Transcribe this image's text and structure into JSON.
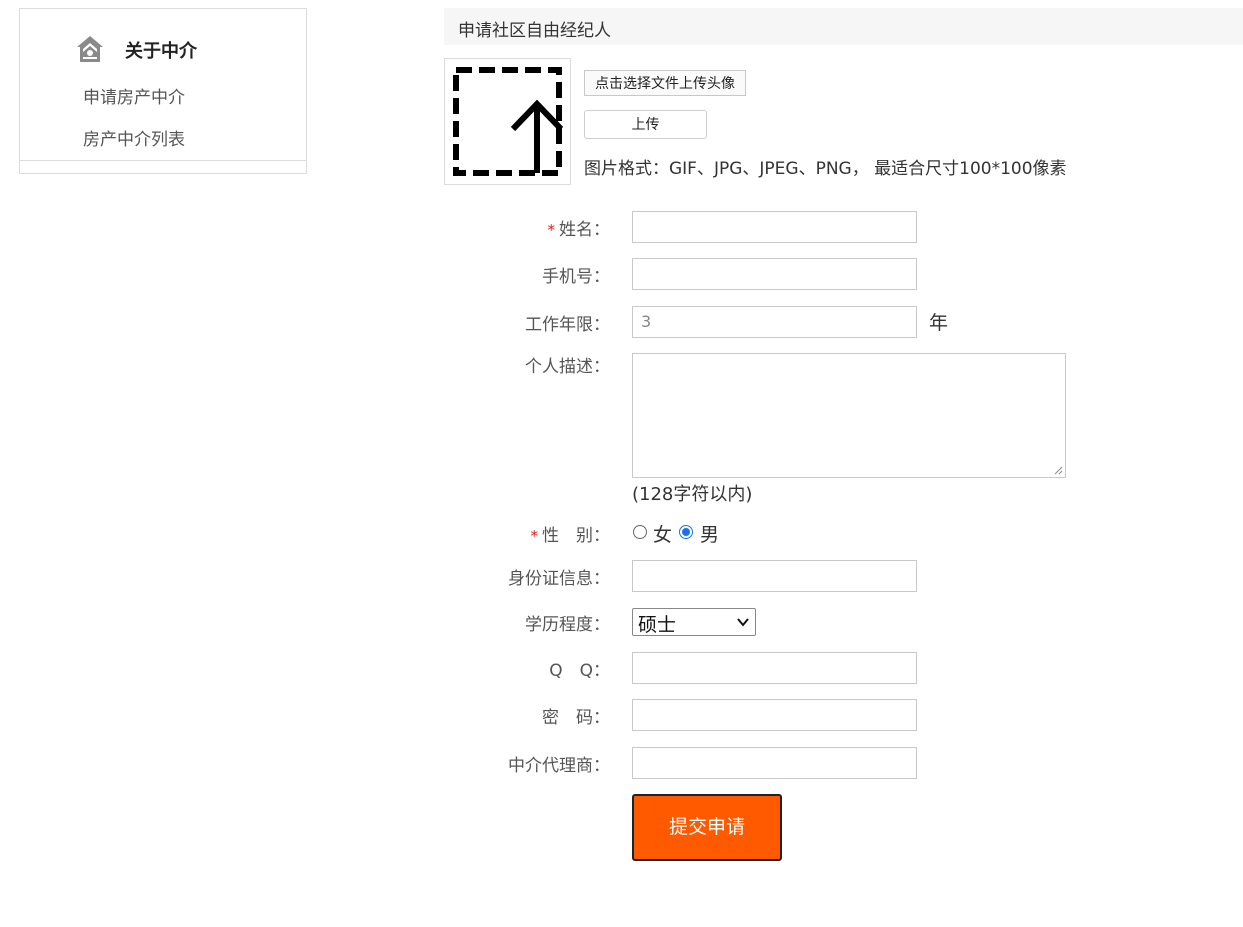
{
  "sidebar": {
    "icon": "house-icon",
    "title": "关于中介",
    "items": [
      {
        "label": "申请房产中介"
      },
      {
        "label": "房产中介列表"
      }
    ]
  },
  "header": {
    "title": "申请社区自由经纪人"
  },
  "avatar": {
    "icon": "upload-arrow-icon",
    "choose_file_label": "点击选择文件上传头像",
    "upload_label": "上传",
    "format_note": "图片格式：GIF、JPG、JPEG、PNG， 最适合尺寸100*100像素"
  },
  "form": {
    "required_mark": "*",
    "name": {
      "label": "姓名：",
      "value": ""
    },
    "phone": {
      "label": "手机号：",
      "value": ""
    },
    "years": {
      "label": "工作年限：",
      "value": "3",
      "unit": "年"
    },
    "description": {
      "label": "个人描述：",
      "value": "",
      "hint": "(128字符以内)"
    },
    "gender": {
      "label": "性　别：",
      "options": [
        {
          "label": "女",
          "checked": false
        },
        {
          "label": "男",
          "checked": true
        }
      ]
    },
    "id_info": {
      "label": "身份证信息：",
      "value": ""
    },
    "education": {
      "label": "学历程度：",
      "selected": "硕士"
    },
    "qq": {
      "label": "Q　Q：",
      "value": ""
    },
    "password": {
      "label": "密　码：",
      "value": ""
    },
    "agency": {
      "label": "中介代理商：",
      "value": ""
    },
    "submit_label": "提交申请"
  },
  "colors": {
    "submit_bg": "#ff5a00",
    "required": "#e0201a",
    "radio_accent": "#1a73e8"
  }
}
